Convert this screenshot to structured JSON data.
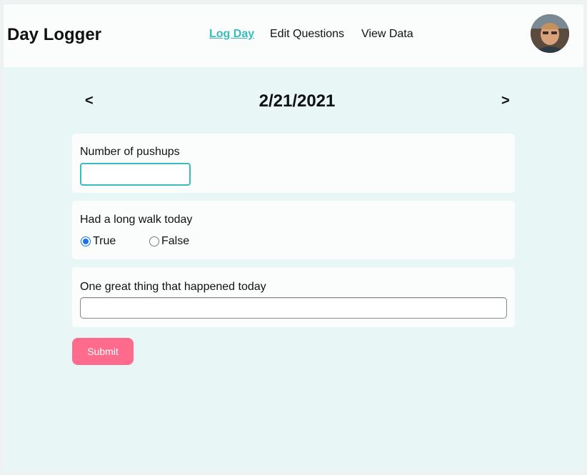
{
  "header": {
    "brand": "Day Logger",
    "nav": [
      {
        "label": "Log Day",
        "active": true
      },
      {
        "label": "Edit Questions",
        "active": false
      },
      {
        "label": "View Data",
        "active": false
      }
    ]
  },
  "date_nav": {
    "prev": "<",
    "date": "2/21/2021",
    "next": ">"
  },
  "questions": [
    {
      "label": "Number of pushups",
      "type": "number",
      "value": ""
    },
    {
      "label": "Had a long walk today",
      "type": "boolean",
      "options": [
        "True",
        "False"
      ],
      "selected": "True"
    },
    {
      "label": "One great thing that happened today",
      "type": "text",
      "value": ""
    }
  ],
  "submit_label": "Submit",
  "colors": {
    "accent": "#3bbcbc",
    "submit": "#ff6b8d",
    "background": "#e8f6f6",
    "card": "#fbfdfd"
  }
}
